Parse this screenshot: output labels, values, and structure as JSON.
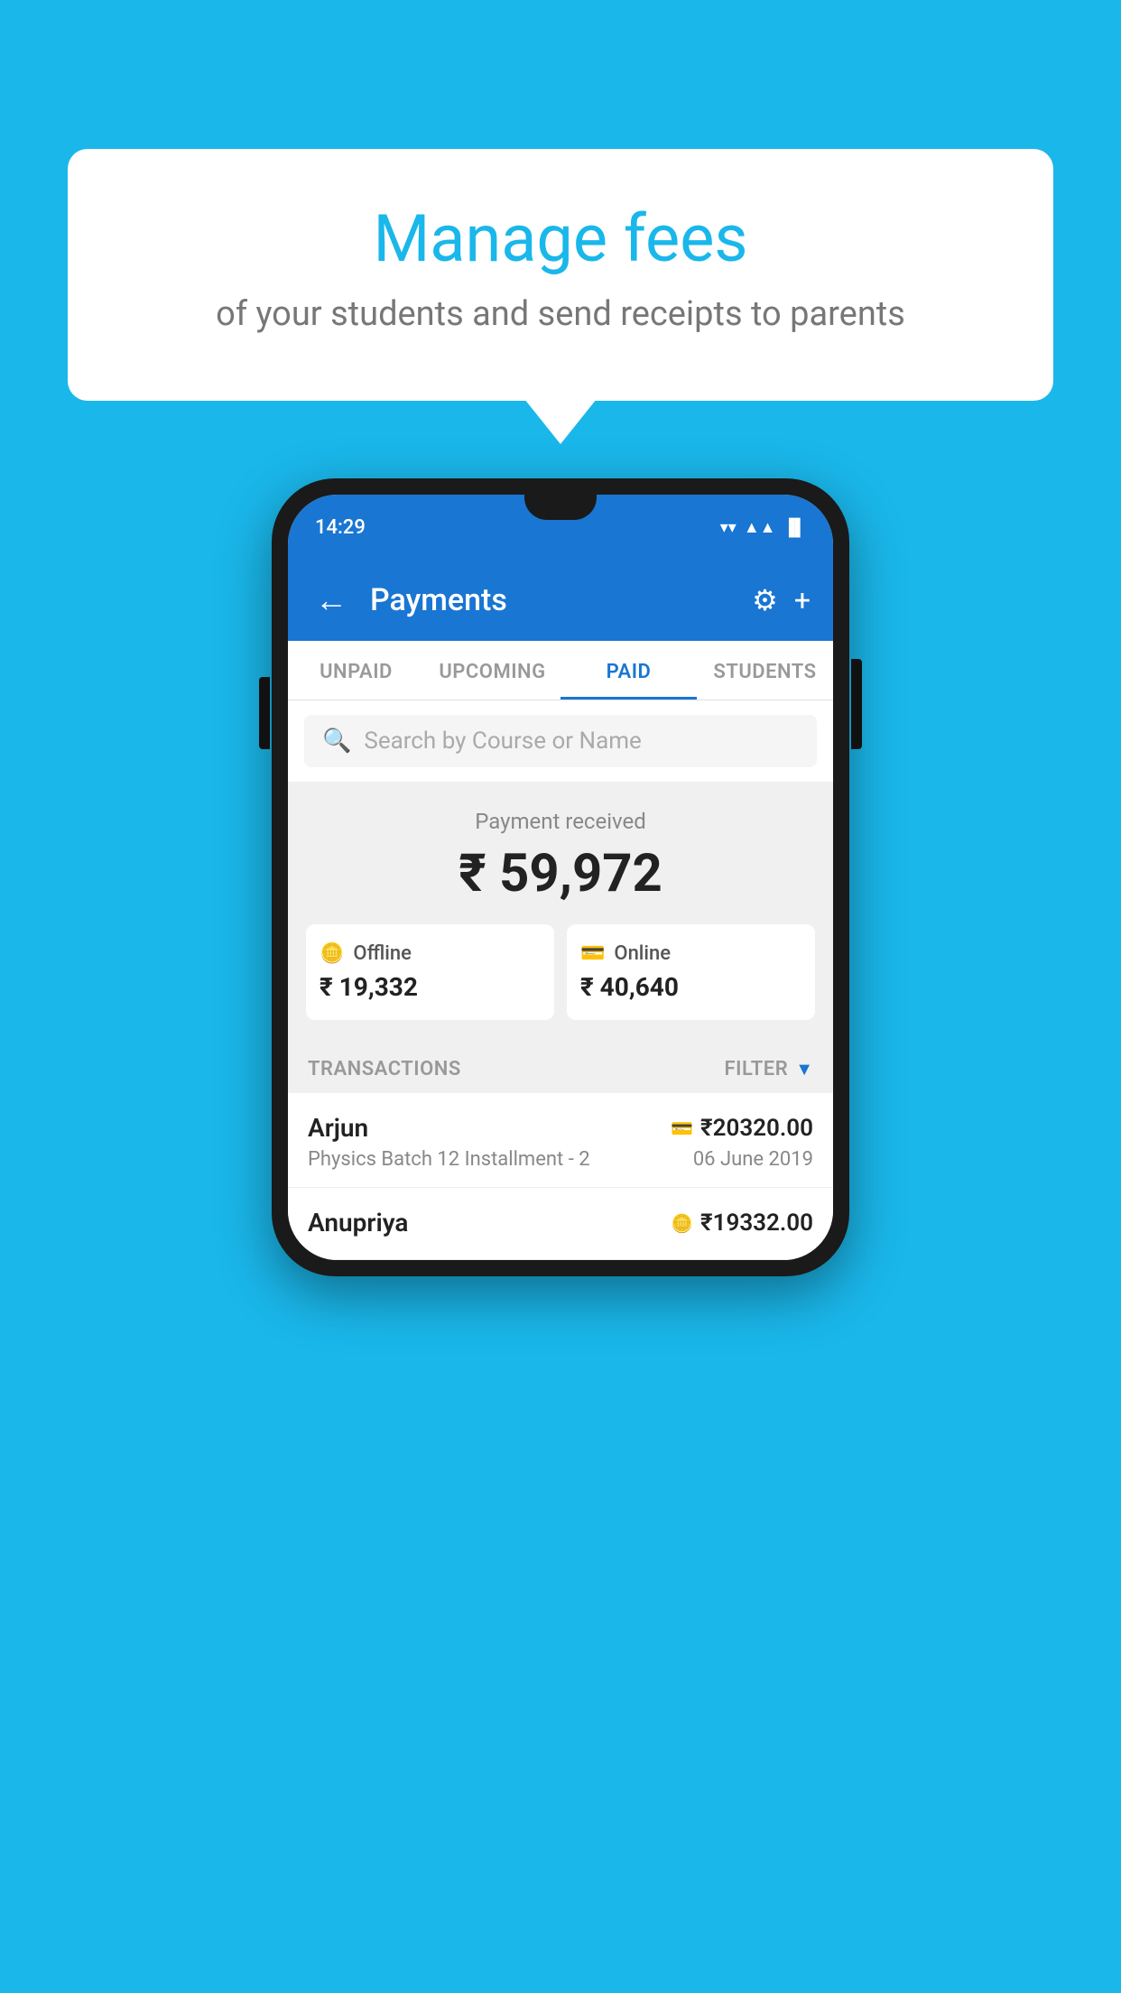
{
  "page": {
    "background_color": "#1ab7ea"
  },
  "speech_bubble": {
    "title": "Manage fees",
    "subtitle": "of your students and send receipts to parents"
  },
  "status_bar": {
    "time": "14:29",
    "wifi_icon": "▼",
    "signal_icon": "▲",
    "battery_icon": "▐"
  },
  "app_bar": {
    "title": "Payments",
    "back_icon": "←",
    "settings_icon": "⚙",
    "add_icon": "+"
  },
  "tabs": [
    {
      "label": "UNPAID",
      "active": false
    },
    {
      "label": "UPCOMING",
      "active": false
    },
    {
      "label": "PAID",
      "active": true
    },
    {
      "label": "STUDENTS",
      "active": false
    }
  ],
  "search": {
    "placeholder": "Search by Course or Name",
    "icon": "🔍"
  },
  "payment_summary": {
    "label": "Payment received",
    "amount": "₹ 59,972",
    "offline": {
      "type": "Offline",
      "amount": "₹ 19,332"
    },
    "online": {
      "type": "Online",
      "amount": "₹ 40,640"
    }
  },
  "transactions": {
    "label": "TRANSACTIONS",
    "filter_label": "FILTER",
    "items": [
      {
        "name": "Arjun",
        "course": "Physics Batch 12 Installment - 2",
        "amount": "₹20320.00",
        "date": "06 June 2019",
        "payment_icon": "card"
      },
      {
        "name": "Anupriya",
        "amount": "₹19332.00",
        "payment_icon": "offline"
      }
    ]
  }
}
